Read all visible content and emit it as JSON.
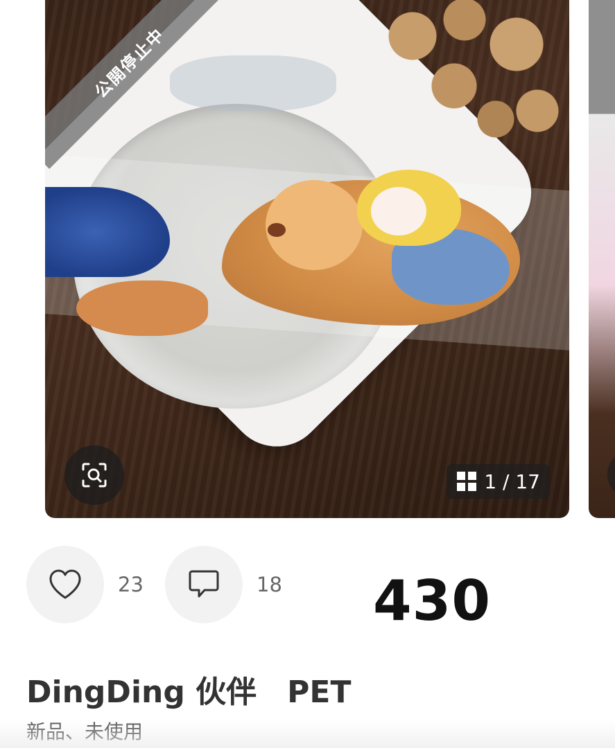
{
  "listing": {
    "status_ribbon": "公開停止中",
    "image_counter": "1 / 17",
    "likes_count": "23",
    "comments_count": "18",
    "price": "430",
    "title": "DingDing 伙伴　PET",
    "condition": "新品、未使用"
  },
  "icons": {
    "zoom": "image-search-icon",
    "gallery": "grid-icon",
    "like": "heart-icon",
    "comment": "speech-bubble-icon"
  }
}
